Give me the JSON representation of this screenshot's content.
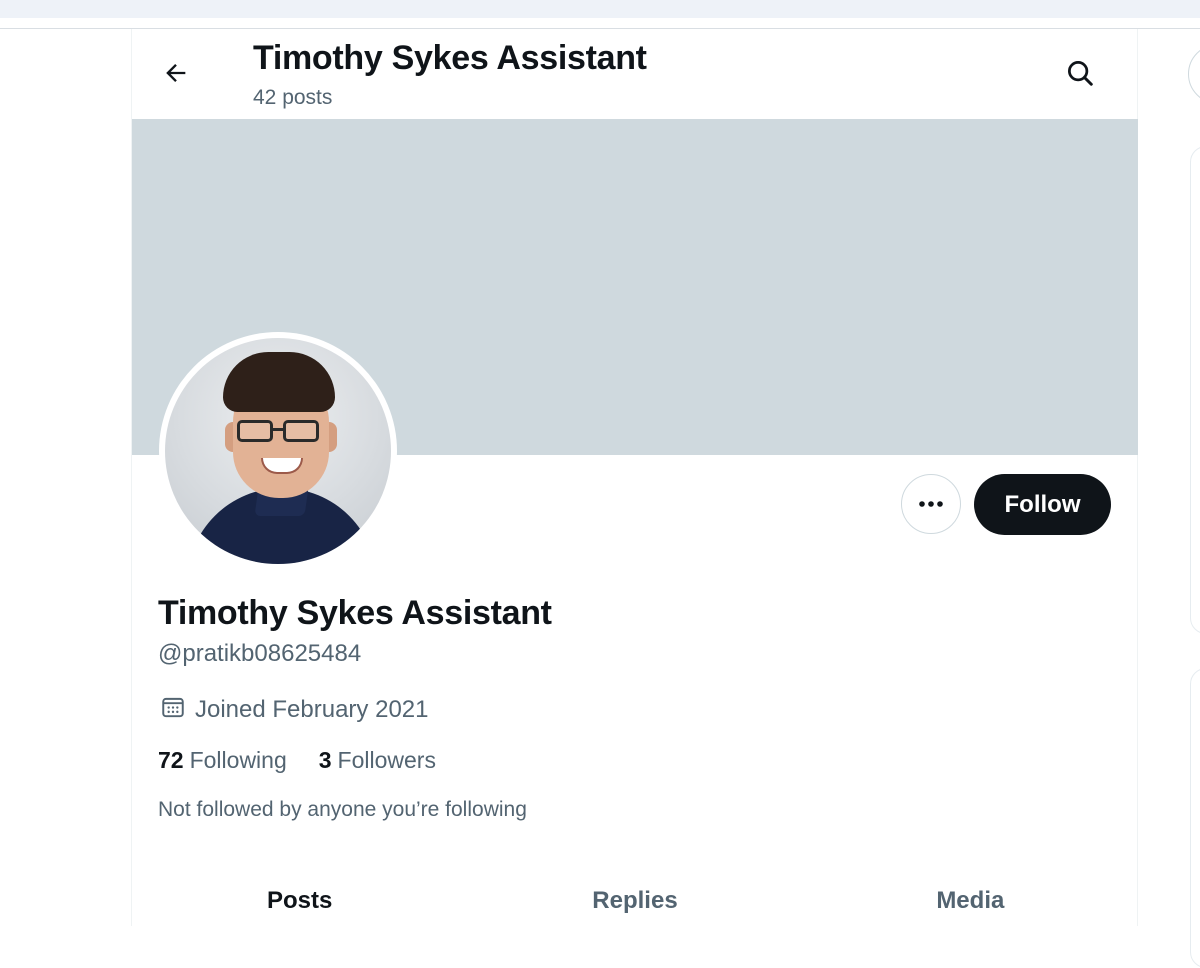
{
  "header": {
    "title": "Timothy Sykes Assistant",
    "post_count": "42 posts"
  },
  "profile": {
    "display_name": "Timothy Sykes Assistant",
    "handle": "@pratikb08625484",
    "joined": "Joined February 2021",
    "following_count": "72",
    "following_label": "Following",
    "followers_count": "3",
    "followers_label": "Followers",
    "mutual_note": "Not followed by anyone you’re following"
  },
  "actions": {
    "follow_label": "Follow"
  },
  "tabs": [
    {
      "label": "Posts",
      "active": true
    },
    {
      "label": "Replies",
      "active": false
    },
    {
      "label": "Media",
      "active": false
    }
  ],
  "colors": {
    "banner": "#cfd9de",
    "primary_text": "#0f1419",
    "secondary_text": "#536471",
    "follow_button_bg": "#0f1419"
  },
  "icons": {
    "back": "back-arrow-icon",
    "search": "search-icon",
    "more": "more-options-icon",
    "calendar": "calendar-icon"
  }
}
